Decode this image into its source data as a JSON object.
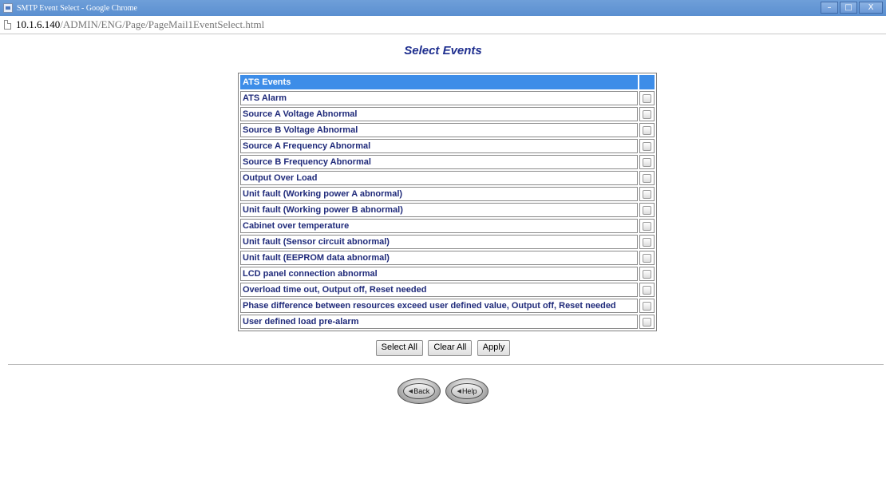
{
  "window": {
    "title": "SMTP Event Select - Google Chrome",
    "controls": {
      "minimize": "–",
      "maximize": "□",
      "close": "X"
    }
  },
  "address": {
    "host": "10.1.6.140",
    "path": "/ADMIN/ENG/Page/PageMail1EventSelect.html"
  },
  "page": {
    "heading": "Select Events"
  },
  "table": {
    "header": "ATS Events",
    "events": [
      {
        "label": "ATS Alarm",
        "checked": false
      },
      {
        "label": "Source A Voltage Abnormal",
        "checked": false
      },
      {
        "label": "Source B Voltage Abnormal",
        "checked": false
      },
      {
        "label": "Source A Frequency Abnormal",
        "checked": false
      },
      {
        "label": "Source B Frequency Abnormal",
        "checked": false
      },
      {
        "label": "Output Over Load",
        "checked": false
      },
      {
        "label": "Unit fault (Working power A abnormal)",
        "checked": false
      },
      {
        "label": "Unit fault (Working power B abnormal)",
        "checked": false
      },
      {
        "label": "Cabinet over temperature",
        "checked": false
      },
      {
        "label": "Unit fault (Sensor circuit abnormal)",
        "checked": false
      },
      {
        "label": "Unit fault (EEPROM data abnormal)",
        "checked": false
      },
      {
        "label": "LCD panel connection abnormal",
        "checked": false
      },
      {
        "label": "Overload time out, Output off, Reset needed",
        "checked": false
      },
      {
        "label": "Phase difference between resources exceed user defined value, Output off, Reset needed",
        "checked": false
      },
      {
        "label": "User defined load pre-alarm",
        "checked": false
      }
    ]
  },
  "buttons": {
    "select_all": "Select All",
    "clear_all": "Clear All",
    "apply": "Apply",
    "back": "Back",
    "help": "Help"
  },
  "colors": {
    "title_bar": "#5a8fd0",
    "heading": "#1f2f8f",
    "table_header": "#3d8de8",
    "row_text": "#1f2a7a"
  }
}
